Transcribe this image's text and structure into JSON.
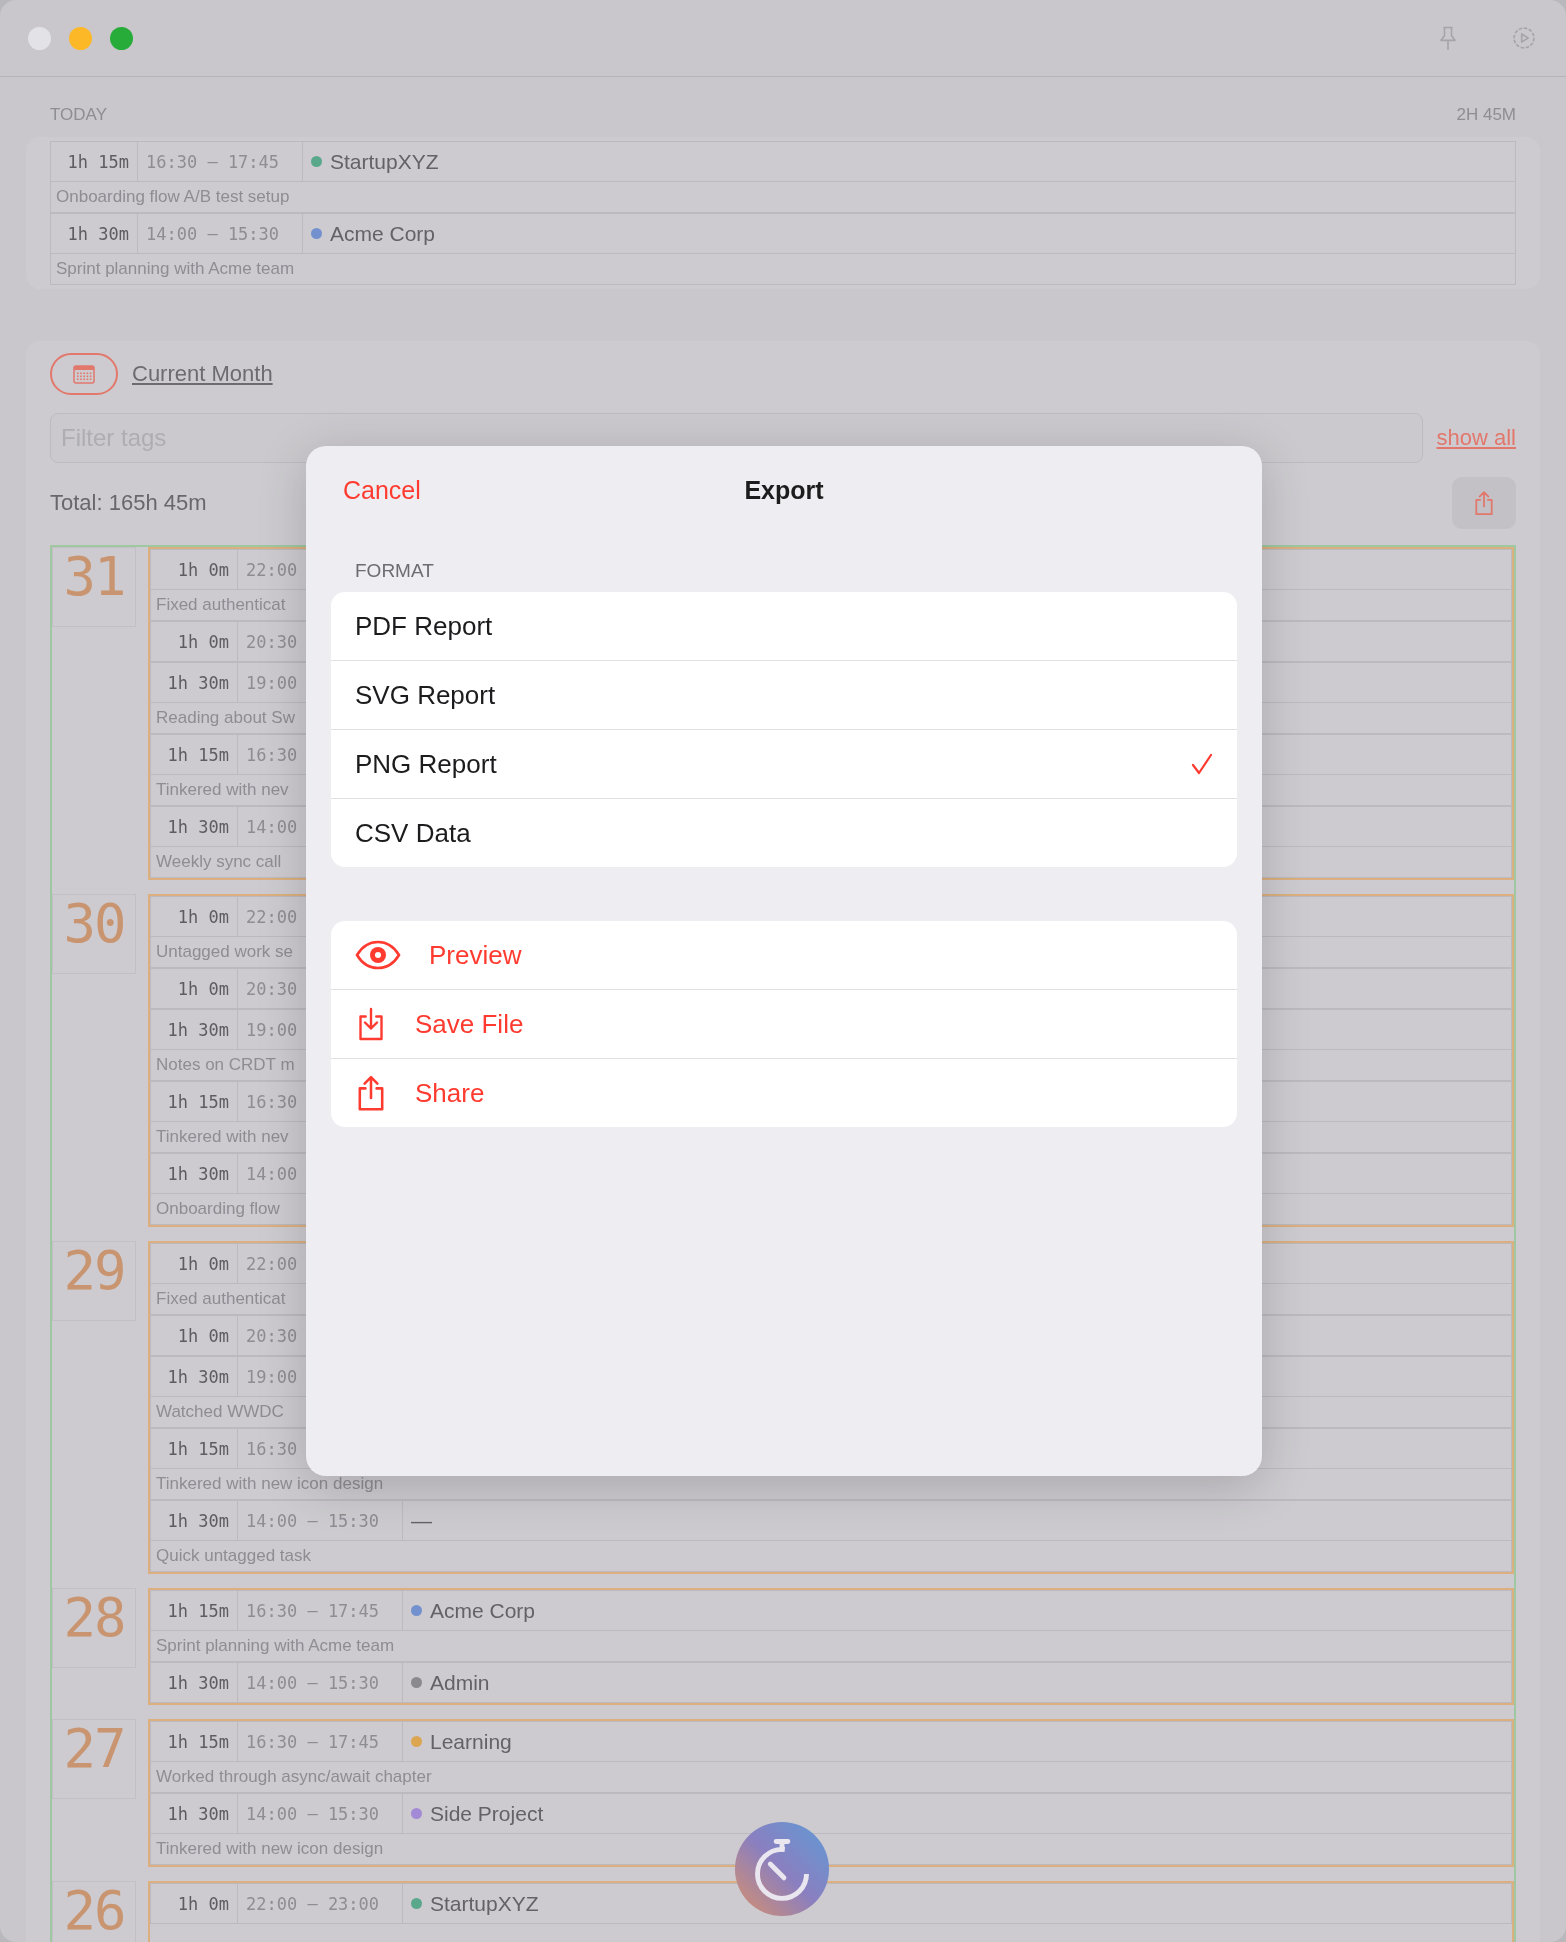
{
  "today": {
    "title": "TODAY",
    "total": "2H 45M",
    "entries": [
      {
        "duration": "1h 15m",
        "time": "16:30 — 17:45",
        "tag": {
          "name": "StartupXYZ",
          "color": "#5aa88c"
        },
        "note": "Onboarding flow A/B test setup"
      },
      {
        "duration": "1h 30m",
        "time": "14:00 — 15:30",
        "tag": {
          "name": "Acme Corp",
          "color": "#7391cf"
        },
        "note": "Sprint planning with Acme team"
      }
    ]
  },
  "month": {
    "period": "Current Month",
    "filter": {
      "placeholder": "Filter tags"
    },
    "show_all": "show all",
    "total": "Total: 165h 45m",
    "days": [
      {
        "day": "31",
        "entries": [
          {
            "duration": "1h 0m",
            "time": "22:00",
            "note": "Fixed authenticat"
          },
          {
            "duration": "1h 0m",
            "time": "20:30"
          },
          {
            "duration": "1h 30m",
            "time": "19:00",
            "note": "Reading about Sw"
          },
          {
            "duration": "1h 15m",
            "time": "16:30",
            "note": "Tinkered with nev"
          },
          {
            "duration": "1h 30m",
            "time": "14:00",
            "note": "Weekly sync call"
          }
        ]
      },
      {
        "day": "30",
        "entries": [
          {
            "duration": "1h 0m",
            "time": "22:00",
            "note": "Untagged work se"
          },
          {
            "duration": "1h 0m",
            "time": "20:30"
          },
          {
            "duration": "1h 30m",
            "time": "19:00",
            "note": "Notes on CRDT m"
          },
          {
            "duration": "1h 15m",
            "time": "16:30",
            "note": "Tinkered with nev"
          },
          {
            "duration": "1h 30m",
            "time": "14:00",
            "note": "Onboarding flow"
          }
        ]
      },
      {
        "day": "29",
        "entries": [
          {
            "duration": "1h 0m",
            "time": "22:00",
            "note": "Fixed authenticat"
          },
          {
            "duration": "1h 0m",
            "time": "20:30"
          },
          {
            "duration": "1h 30m",
            "time": "19:00",
            "note": "Watched WWDC"
          },
          {
            "duration": "1h 15m",
            "time": "16:30",
            "note": "Tinkered with new icon design"
          },
          {
            "duration": "1h 30m",
            "time": "14:00 — 15:30",
            "tag": {
              "name": "—"
            },
            "note": "Quick untagged task"
          }
        ]
      },
      {
        "day": "28",
        "entries": [
          {
            "duration": "1h 15m",
            "time": "16:30 — 17:45",
            "tag": {
              "name": "Acme Corp",
              "color": "#7391cf"
            },
            "note": "Sprint planning with Acme team"
          },
          {
            "duration": "1h 30m",
            "time": "14:00 — 15:30",
            "tag": {
              "name": "Admin",
              "color": "#8a898e"
            }
          }
        ]
      },
      {
        "day": "27",
        "entries": [
          {
            "duration": "1h 15m",
            "time": "16:30 — 17:45",
            "tag": {
              "name": "Learning",
              "color": "#dca651"
            },
            "note": "Worked through async/await chapter"
          },
          {
            "duration": "1h 30m",
            "time": "14:00 — 15:30",
            "tag": {
              "name": "Side Project",
              "color": "#a38ad6"
            },
            "note": "Tinkered with new icon design"
          }
        ]
      },
      {
        "day": "26",
        "entries": [
          {
            "duration": "1h 0m",
            "time": "22:00 — 23:00",
            "tag": {
              "name": "StartupXYZ",
              "color": "#5aa88c"
            }
          }
        ]
      }
    ]
  },
  "export_dialog": {
    "cancel": "Cancel",
    "title": "Export",
    "section": "FORMAT",
    "formats": [
      {
        "label": "PDF Report",
        "selected": false
      },
      {
        "label": "SVG Report",
        "selected": false
      },
      {
        "label": "PNG Report",
        "selected": true
      },
      {
        "label": "CSV Data",
        "selected": false
      }
    ],
    "actions": [
      {
        "label": "Preview"
      },
      {
        "label": "Save File"
      },
      {
        "label": "Share"
      }
    ]
  }
}
